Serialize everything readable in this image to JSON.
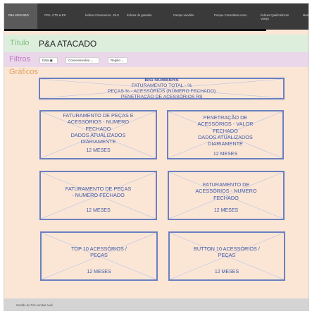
{
  "nav": {
    "tabs": [
      {
        "label": "P&A ATACADO",
        "active": true
      },
      {
        "label": "CRA, CTS & RS",
        "active": false
      },
      {
        "label": "Índices Financeiros - DLS",
        "active": false
      },
      {
        "label": "Índices de garantia",
        "active": false
      },
      {
        "label": "Campo vendido",
        "active": false
      },
      {
        "label": "Porque Consultoria Anos",
        "active": false
      },
      {
        "label": "Índices Qualimétricos Varejo",
        "active": false
      },
      {
        "label": "Mais",
        "active": false
      }
    ]
  },
  "title_section": {
    "label": "Título",
    "value": "P&A ATACADO"
  },
  "filter_section": {
    "label": "Filtros",
    "filters": [
      {
        "label": "Data",
        "icon": "calendar-icon"
      },
      {
        "label": "Concessionária",
        "icon": "chevron-down-icon"
      },
      {
        "label": "Região",
        "icon": "chevron-down-icon"
      }
    ]
  },
  "graphs_section": {
    "label": "Gráficos",
    "big_numbers": {
      "lines": [
        "BIG NUMBERS",
        "FATURAMENTO TOTAL - %",
        "PEÇAS % - ACESSÓRIOS (NÚMERO FECHADO)",
        "PENETRAÇÃO DE ACESSÓRIOS R$"
      ]
    },
    "cards": [
      {
        "lines": [
          "FATURAMENTO DE PEÇAS E",
          "ACESSÓRIOS - NUMERO",
          "FECHADO",
          "DADOS ATUALIZADOS",
          "DIARIAMENTE"
        ],
        "sub": "12 MESES"
      },
      {
        "lines": [
          "PENETRAÇÃO DE",
          "ACESSÓRIOS - VALOR",
          "FECHADO",
          "DADOS ATUALIZADOS",
          "DIARIAMENTE"
        ],
        "sub": "12 MESES"
      },
      {
        "lines": [
          "FATURAMENTO DE PEÇAS",
          "- NUMERO FECHADO"
        ],
        "sub": "12 MESES"
      },
      {
        "lines": [
          "FATURAMENTO DE",
          "ACESSÓRIOS - NUMERO",
          "FECHADO"
        ],
        "sub": "12 MESES"
      },
      {
        "lines": [
          "TOP 10 ACESSÓRIOS /",
          "PEÇAS"
        ],
        "sub": "12 MESES"
      },
      {
        "lines": [
          "BUTTON 10 ACESSÓRIOS /",
          "PEÇAS"
        ],
        "sub": "12 MESES"
      }
    ]
  },
  "footer": {
    "text": "Gestão de Pós vendas Audi"
  },
  "colors": {
    "background": "#fbe6d6",
    "title_band": "#ddeedd",
    "filter_band": "#ead8ea",
    "box_border": "#6b80c0",
    "box_text": "#3f58a8",
    "nav_bg": "#3a3a3a"
  }
}
